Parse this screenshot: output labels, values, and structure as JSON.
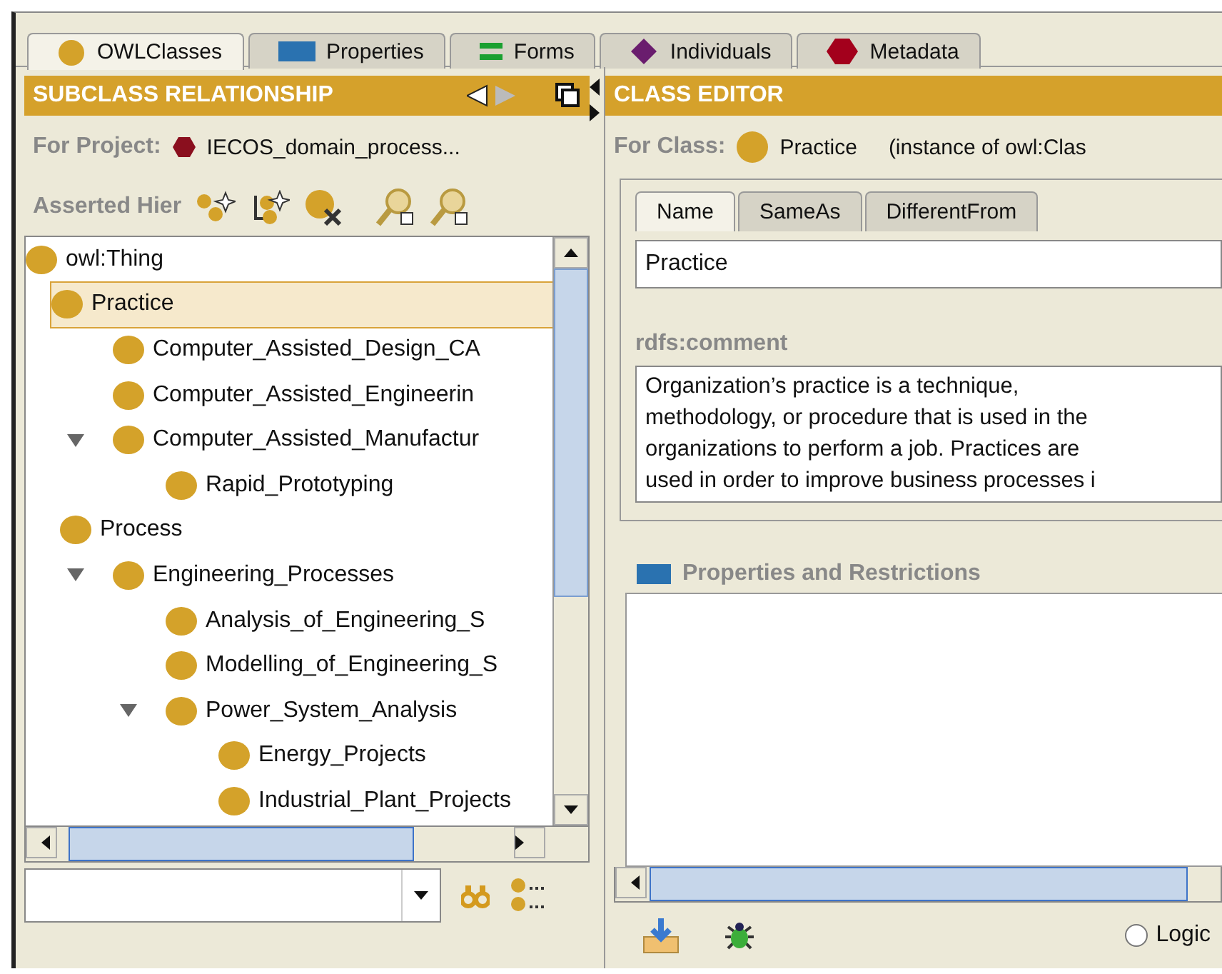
{
  "tabs": [
    {
      "label": "OWLClasses",
      "selected": true
    },
    {
      "label": "Properties",
      "selected": false
    },
    {
      "label": "Forms",
      "selected": false
    },
    {
      "label": "Individuals",
      "selected": false
    },
    {
      "label": "Metadata",
      "selected": false
    }
  ],
  "left_panel": {
    "title": "SUBCLASS RELATIONSHIP",
    "project_label": "For Project:",
    "project_name": "IECOS_domain_process...",
    "hierarchy_label": "Asserted Hier",
    "tree": [
      {
        "label": "owl:Thing",
        "selected": false,
        "children": [
          {
            "label": "Practice",
            "selected": true,
            "children": [
              {
                "label": "Computer_Assisted_Design_CA",
                "selected": false
              },
              {
                "label": "Computer_Assisted_Engineerin",
                "selected": false
              },
              {
                "label": "Computer_Assisted_Manufactur",
                "selected": false,
                "expanded": true,
                "children": [
                  {
                    "label": "Rapid_Prototyping",
                    "selected": false
                  }
                ]
              }
            ]
          },
          {
            "label": "Process",
            "selected": false,
            "children": [
              {
                "label": "Engineering_Processes",
                "selected": false,
                "expanded": true,
                "children": [
                  {
                    "label": "Analysis_of_Engineering_S",
                    "selected": false
                  },
                  {
                    "label": "Modelling_of_Engineering_S",
                    "selected": false
                  },
                  {
                    "label": "Power_System_Analysis",
                    "selected": false,
                    "expanded": true,
                    "children": [
                      {
                        "label": "Energy_Projects",
                        "selected": false
                      },
                      {
                        "label": "Industrial_Plant_Projects",
                        "selected": false
                      }
                    ]
                  }
                ]
              }
            ]
          }
        ]
      }
    ]
  },
  "right_panel": {
    "title": "CLASS EDITOR",
    "class_label": "For Class:",
    "class_name": "Practice",
    "class_type": "(instance of owl:Clas",
    "subtabs": [
      {
        "label": "Name",
        "selected": true
      },
      {
        "label": "SameAs",
        "selected": false
      },
      {
        "label": "DifferentFrom",
        "selected": false
      }
    ],
    "name_value": "Practice",
    "comment_label": "rdfs:comment",
    "comment_lines": [
      "Organization’s practice is a technique,",
      "methodology, or procedure that is used in the",
      "organizations to perform a job. Practices are",
      "used in order to improve business processes i"
    ],
    "restrictions_label": "Properties and Restrictions",
    "logic_radio": {
      "label": "Logic",
      "checked": false
    }
  }
}
